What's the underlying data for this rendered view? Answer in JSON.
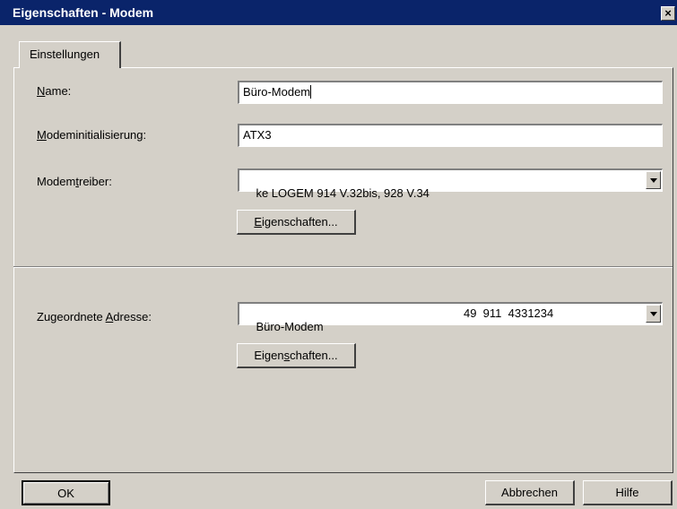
{
  "window": {
    "title": "Eigenschaften - Modem",
    "close_glyph": "×"
  },
  "tabs": [
    {
      "label": "Einstellungen"
    }
  ],
  "fields": {
    "name": {
      "label_pre": "",
      "label_key": "N",
      "label_post": "ame:",
      "value": "Büro-Modem"
    },
    "init": {
      "label_pre": "",
      "label_key": "M",
      "label_post": "odeminitialisierung:",
      "value": "ATX3"
    },
    "driver": {
      "label_pre": "Modem",
      "label_key": "t",
      "label_post": "reiber:",
      "value": "ke LOGEM 914 V.32bis, 928 V.34"
    },
    "address": {
      "label_pre": "Zugeordnete ",
      "label_key": "A",
      "label_post": "dresse:",
      "value_name": "Büro-Modem",
      "value_phone": "49  911  4331234"
    }
  },
  "buttons": {
    "driver_props": {
      "pre": "",
      "key": "E",
      "post": "igenschaften..."
    },
    "address_props": {
      "pre": "Eigen",
      "key": "s",
      "post": "chaften..."
    },
    "ok": "OK",
    "cancel": "Abbrechen",
    "help": "Hilfe"
  },
  "icons": {
    "close": "close-icon",
    "dropdown": "chevron-down-icon"
  }
}
